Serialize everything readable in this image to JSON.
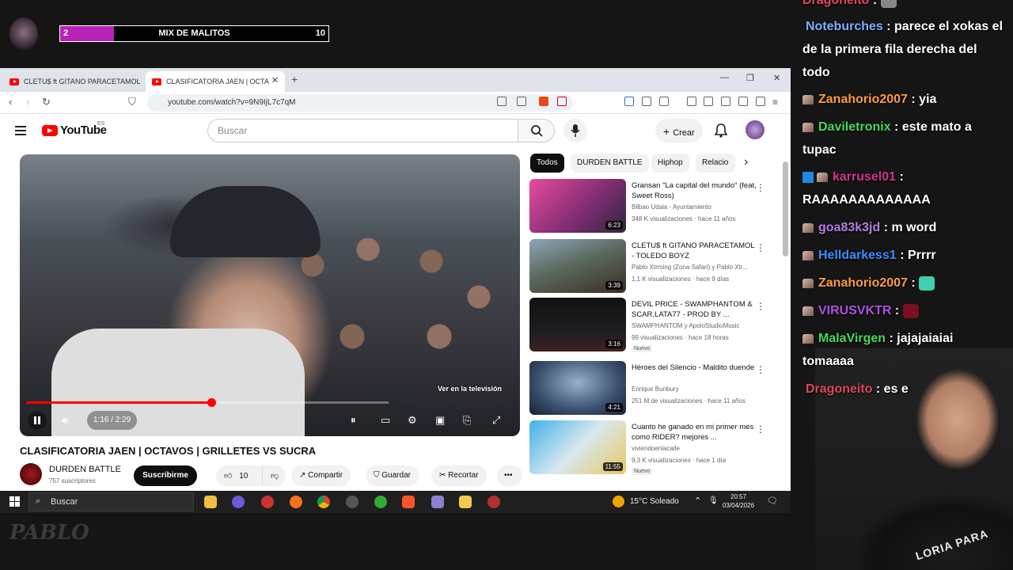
{
  "overlay": {
    "progress_start": "2",
    "progress_title": "MIX DE MALITOS",
    "progress_end": "10",
    "progress_fraction": 0.2,
    "accent_color": "#b824b8",
    "streamer_logo": "PABLO"
  },
  "browser": {
    "tabs": [
      {
        "label": "CLETU$ ft GITANO PARACETAMOL -"
      },
      {
        "label": "CLASIFICATORIA JAEN | OCTA"
      }
    ],
    "url": "youtube.com/watch?v=9N9IjL7c7qM"
  },
  "youtube": {
    "logo_text": "YouTube",
    "logo_region": "ES",
    "search_placeholder": "Buscar",
    "create_label": "Crear",
    "player": {
      "time": "1:16 / 2:29",
      "progress_fraction": 0.51,
      "tv_label": "Ver en la televisión"
    },
    "video_title": "CLASIFICATORIA JAEN | OCTAVOS | GRILLETES VS SUCRA",
    "channel": {
      "name": "DURDEN BATTLE",
      "subs": "757 suscriptores"
    },
    "subscribe_label": "Suscribirme",
    "actions": {
      "likes": "10",
      "share": "Compartir",
      "save": "Guardar",
      "clip": "Recortar"
    },
    "chips": [
      "Todos",
      "DURDEN BATTLE",
      "Hiphop",
      "Relacio"
    ],
    "recommendations": [
      {
        "title": "Gransan \"La capital del mundo\" (feat, Sweet Ross)",
        "channel": "Bilbao Udala - Ayuntamiento",
        "meta": "348 K visualizaciones · hace 11 años",
        "duration": "6:23",
        "badge": ""
      },
      {
        "title": "CLETU$ ft GITANO PARACETAMOL - TOLEDO BOYZ",
        "channel": "Pablo Xtrming (Zona Safari) y Pablo Xtr...",
        "meta": "1,1 K visualizaciones · hace 9 días",
        "duration": "3:39",
        "badge": ""
      },
      {
        "title": "DEVIL PRICE - SWAMPHANTOM & SCAR.LATA77 - PROD BY ...",
        "channel": "SWAMPHANTOM y ApoloStudioMusic",
        "meta": "99 visualizaciones · hace 18 horas",
        "duration": "3:16",
        "badge": "Nuevo"
      },
      {
        "title": "Héroes del Silencio - Maldito duende",
        "channel": "Enrique Bunbury",
        "meta": "251 M de visualizaciones · hace 11 años",
        "duration": "4:21",
        "badge": ""
      },
      {
        "title": "Cuanto he ganado en mi primer mes como RIDER? mejores ...",
        "channel": "viviendoenlacalle",
        "meta": "9,3 K visualizaciones · hace 1 día",
        "duration": "11:55",
        "badge": "Nuevo"
      }
    ]
  },
  "taskbar": {
    "search_placeholder": "Buscar",
    "weather": "15°C  Soleado",
    "time": "20:57",
    "date": "03/04/2026"
  },
  "chat": [
    {
      "user": "Dragoneito",
      "color": "#e0475f",
      "text": ":",
      "badge": "none"
    },
    {
      "user": "Noteburches",
      "color": "#7ab0ff",
      "text": ": parece el xokas el de la primera fila derecha del todo",
      "badge": "none"
    },
    {
      "user": "Zanahorio2007",
      "color": "#ff9d3c",
      "text": ": yia",
      "badge": "mod"
    },
    {
      "user": "Daviletronix",
      "color": "#45d95c",
      "text": ": este mato a tupac",
      "badge": "mod"
    },
    {
      "user": "karrusel01",
      "color": "#d0368a",
      "text": ": RAAAAAAAAAAAAA",
      "badge": "prime"
    },
    {
      "user": "goa83k3jd",
      "color": "#b47ee5",
      "text": ": m word",
      "badge": "mod"
    },
    {
      "user": "Helldarkess1",
      "color": "#3b8cff",
      "text": ": Prrrr",
      "badge": "mod"
    },
    {
      "user": "Zanahorio2007",
      "color": "#ff9d3c",
      "text": ":",
      "badge": "mod"
    },
    {
      "user": "VIRUSVKTR",
      "color": "#b24ee0",
      "text": ":",
      "badge": "mod"
    },
    {
      "user": "MalaVirgen",
      "color": "#45d95c",
      "text": ": jajajaiaiai tomaaaa",
      "badge": "mod"
    },
    {
      "user": "Dragoneito",
      "color": "#e0475f",
      "text": ": es e",
      "badge": "none"
    }
  ],
  "cam_text": "LORIA PARA"
}
